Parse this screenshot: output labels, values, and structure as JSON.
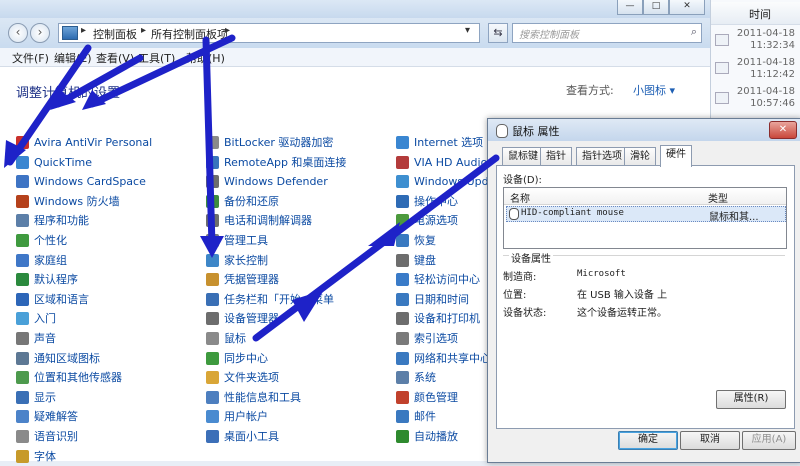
{
  "window": {
    "min_label": "—",
    "max_label": "□",
    "close_label": "✕"
  },
  "address": {
    "crumbs": [
      "控制面板",
      "所有控制面板项"
    ],
    "search_placeholder": "搜索控制面板"
  },
  "menu": [
    "文件(F)",
    "编辑(E)",
    "查看(V)",
    "工具(T)",
    "帮助(H)"
  ],
  "header": {
    "title": "调整计算机的设置",
    "view_by_label": "查看方式:",
    "view_by_value": "小图标 ▾"
  },
  "columns": [
    [
      {
        "label": "Avira AntiVir Personal",
        "color": "#c9302c"
      },
      {
        "label": "QuickTime",
        "color": "#3a86d1"
      },
      {
        "label": "Windows CardSpace",
        "color": "#3e74c4"
      },
      {
        "label": "Windows 防火墙",
        "color": "#b5411c"
      },
      {
        "label": "程序和功能",
        "color": "#5c7fa8"
      },
      {
        "label": "个性化",
        "color": "#3f9a3f"
      },
      {
        "label": "家庭组",
        "color": "#3f77c7"
      },
      {
        "label": "默认程序",
        "color": "#2b8a3e"
      },
      {
        "label": "区域和语言",
        "color": "#2d66b8"
      },
      {
        "label": "入门",
        "color": "#4aa0d8"
      },
      {
        "label": "声音",
        "color": "#777777"
      },
      {
        "label": "通知区域图标",
        "color": "#5d7894"
      },
      {
        "label": "位置和其他传感器",
        "color": "#4d9a4d"
      },
      {
        "label": "显示",
        "color": "#3a6fb5"
      },
      {
        "label": "疑难解答",
        "color": "#4c83c9"
      },
      {
        "label": "语音识别",
        "color": "#8a8a8a"
      },
      {
        "label": "字体",
        "color": "#c79a2a"
      }
    ],
    [
      {
        "label": "BitLocker 驱动器加密",
        "color": "#8a8a8a"
      },
      {
        "label": "RemoteApp 和桌面连接",
        "color": "#3874bd"
      },
      {
        "label": "Windows Defender",
        "color": "#6d6d6d"
      },
      {
        "label": "备份和还原",
        "color": "#3e8c3e"
      },
      {
        "label": "电话和调制解调器",
        "color": "#6d6d6d"
      },
      {
        "label": "管理工具",
        "color": "#7a7a7a"
      },
      {
        "label": "家长控制",
        "color": "#3d86c7"
      },
      {
        "label": "凭据管理器",
        "color": "#c7912f"
      },
      {
        "label": "任务栏和「开始」菜单",
        "color": "#3a6fb5"
      },
      {
        "label": "设备管理器",
        "color": "#6d6d6d"
      },
      {
        "label": "鼠标",
        "color": "#8a8a8a"
      },
      {
        "label": "同步中心",
        "color": "#3e9a3e"
      },
      {
        "label": "文件夹选项",
        "color": "#d9a637"
      },
      {
        "label": "性能信息和工具",
        "color": "#4d7fbf"
      },
      {
        "label": "用户帐户",
        "color": "#4a8bd0"
      },
      {
        "label": "桌面小工具",
        "color": "#3c6fb8"
      }
    ],
    [
      {
        "label": "Internet 选项",
        "color": "#3a86d1"
      },
      {
        "label": "VIA HD Audio Deck",
        "color": "#b33b3b"
      },
      {
        "label": "Windows Update",
        "color": "#3e8fd0"
      },
      {
        "label": "操作中心",
        "color": "#2e6bb5"
      },
      {
        "label": "电源选项",
        "color": "#4c9a3d"
      },
      {
        "label": "恢复",
        "color": "#3a79c0"
      },
      {
        "label": "键盘",
        "color": "#6d6d6d"
      },
      {
        "label": "轻松访问中心",
        "color": "#3a7bc8"
      },
      {
        "label": "日期和时间",
        "color": "#3a79c0"
      },
      {
        "label": "设备和打印机",
        "color": "#6d6d6d"
      },
      {
        "label": "索引选项",
        "color": "#7a7a7a"
      },
      {
        "label": "网络和共享中心",
        "color": "#3a79c0"
      },
      {
        "label": "系统",
        "color": "#5c7fa8"
      },
      {
        "label": "颜色管理",
        "color": "#c1412c"
      },
      {
        "label": "邮件",
        "color": "#3a79c0"
      },
      {
        "label": "自动播放",
        "color": "#2e8a2e"
      }
    ]
  ],
  "right_pane": {
    "header": "时间",
    "rows": [
      {
        "date": "2011-04-18",
        "time": "11:32:34"
      },
      {
        "date": "2011-04-18",
        "time": "11:12:42"
      },
      {
        "date": "2011-04-18",
        "time": "10:57:46"
      }
    ]
  },
  "dialog": {
    "title": "鼠标 属性",
    "close_label": "✕",
    "tabs": [
      "鼠标键",
      "指针",
      "指针选项",
      "滑轮",
      "硬件"
    ],
    "devices_label": "设备(D):",
    "col_name": "名称",
    "col_type": "类型",
    "device_name": "HID-compliant mouse",
    "device_type": "鼠标和其...",
    "properties_title": "设备属性",
    "manufacturer_label": "制造商:",
    "manufacturer_value": "Microsoft",
    "location_label": "位置:",
    "location_value": "在 USB 输入设备 上",
    "status_label": "设备状态:",
    "status_value": "这个设备运转正常。",
    "properties_button": "属性(R)",
    "ok_button": "确定",
    "cancel_button": "取消",
    "apply_button": "应用(A)"
  }
}
